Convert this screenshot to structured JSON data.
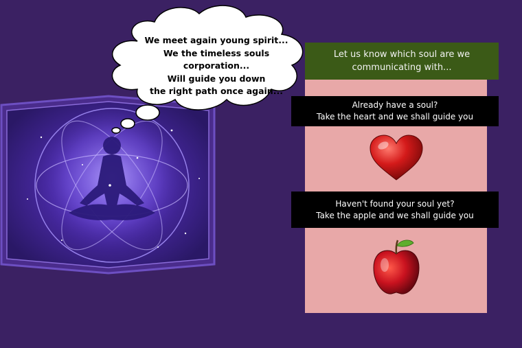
{
  "thought_bubble": {
    "text": "We meet again young spirit...\nWe the timeless souls\ncorporation...\nWill guide you down\nthe right path once again..."
  },
  "panel": {
    "header": "Let us know which soul are we\ncommunicating with...",
    "heart_option": {
      "text": "Already have a soul?\nTake the heart and we shall guide you",
      "icon": "heart-icon"
    },
    "apple_option": {
      "text": "Haven't found your soul yet?\nTake the apple and we shall guide you",
      "icon": "apple-icon"
    }
  },
  "colors": {
    "background": "#3b2163",
    "header": "#3b5a17",
    "panel": "#e8a8a8",
    "card": "#000000",
    "heart": "#d41a1a",
    "apple": "#c9121f"
  }
}
